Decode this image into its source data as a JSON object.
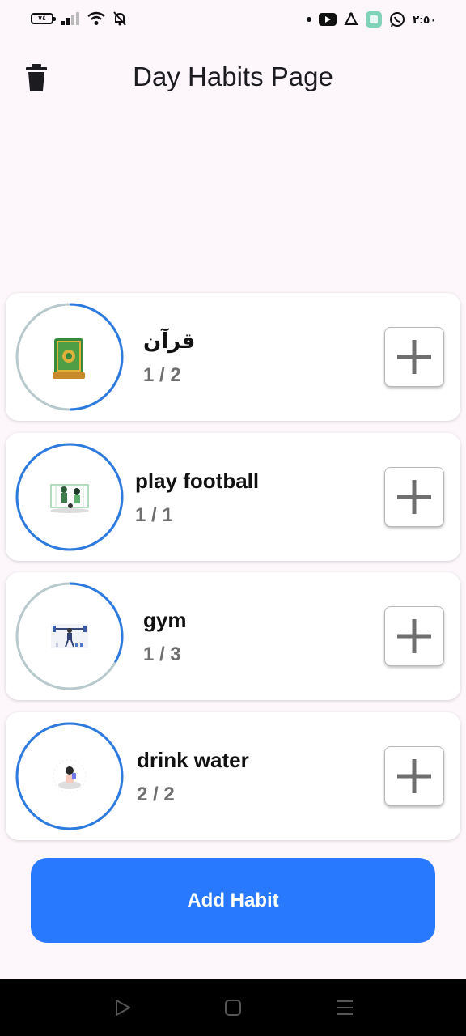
{
  "status_bar": {
    "battery": "٧٤",
    "time": "٢:٥٠",
    "left_icons": [
      "battery-icon",
      "signal-icon",
      "wifi-icon",
      "bell-off-icon"
    ],
    "right_icons": [
      "notification-dot-icon",
      "youtube-icon",
      "app-icon",
      "gallery-icon",
      "whatsapp-icon"
    ]
  },
  "app_bar": {
    "title": "Day Habits Page",
    "delete_icon": "trash-icon"
  },
  "habits": [
    {
      "name": "قرآن",
      "count": "1 / 2",
      "progress": 0.5,
      "icon": "quran-book-icon"
    },
    {
      "name": "play football",
      "count": "1 / 1",
      "progress": 1.0,
      "icon": "football-illustration"
    },
    {
      "name": "gym",
      "count": "1 / 3",
      "progress": 0.333,
      "icon": "gym-illustration"
    },
    {
      "name": "drink water",
      "count": "2 / 2",
      "progress": 1.0,
      "icon": "drink-water-illustration"
    }
  ],
  "add_button": {
    "label": "Add Habit"
  },
  "nav_bar": {
    "icons": [
      "back-icon",
      "home-icon",
      "recents-icon"
    ]
  },
  "colors": {
    "accent": "#2979ff",
    "ring_progress": "#2e7be0",
    "ring_track": "#b7c9cc",
    "background": "#fdf7fc"
  }
}
